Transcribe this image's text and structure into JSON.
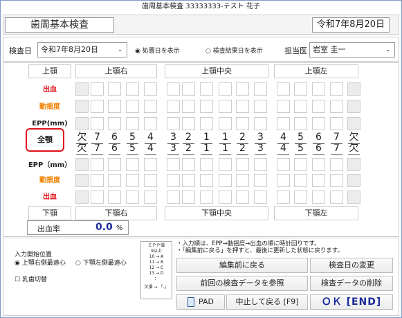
{
  "window": {
    "title": "歯周基本検査 33333333-テスト 花子"
  },
  "header": {
    "title": "歯周基本検査",
    "date": "令和7年8月20日"
  },
  "filters": {
    "exam_date_label": "検査日",
    "exam_date_value": "令和7年8月20日",
    "radio_treatment": "処置日を表示",
    "radio_results": "検査結果日を表示",
    "doctor_label": "担当医",
    "doctor_value": "岩室 圭一"
  },
  "chart": {
    "upper_label": "上顎",
    "upper_right": "上顎右",
    "upper_center": "上顎中央",
    "upper_left": "上顎左",
    "lower_label": "下顎",
    "lower_right": "下顎右",
    "lower_center": "下顎中央",
    "lower_left": "下顎左",
    "row_bleeding": "出血",
    "row_mobility": "動揺度",
    "row_epp_upper": "EPP(mm)",
    "row_epp_lower": "EPP（mm）",
    "full_jaw": "全顎",
    "upper_teeth": [
      "欠",
      "7",
      "6",
      "5",
      "4",
      "3",
      "2",
      "1",
      "1",
      "2",
      "3",
      "4",
      "5",
      "6",
      "7",
      "欠"
    ],
    "lower_teeth": [
      "欠",
      "7",
      "6",
      "5",
      "4",
      "3",
      "2",
      "1",
      "1",
      "2",
      "3",
      "4",
      "5",
      "6",
      "7",
      "欠"
    ],
    "colors": {
      "bleeding": "#e0101a",
      "mobility": "#f08000",
      "highlight": "#e0101a"
    }
  },
  "stats": {
    "bleeding_rate_label": "出血率",
    "bleeding_rate_value": "0.0",
    "bleeding_rate_unit": "%"
  },
  "bottom": {
    "input_start_label": "入力開始位置",
    "radio_upper_right": "上顎右側最遠心",
    "radio_lower_left": "下顎左側最遠心",
    "checkbox_baby": "乳歯切替",
    "legend": {
      "title": "ＥＰＰ値",
      "lines": [
        "9以上",
        "10 → A",
        "11 → B",
        "12 → C",
        "13 → D",
        "：",
        "欠損 → 「-」"
      ]
    },
    "note1": "・入力順は、EPP→動揺度→出血の順に時計回りです。",
    "note2": "・「編集前に戻る」を押すと、最後に更新した状態に戻ります。",
    "btn_revert": "編集前に戻る",
    "btn_change_date": "検査日の変更",
    "btn_ref_prev": "前回の検査データを参照",
    "btn_delete": "検査データの削除",
    "btn_pad": "PAD",
    "btn_cancel": "中止して戻る [F9]",
    "btn_ok": "ＯＫ [END]"
  }
}
